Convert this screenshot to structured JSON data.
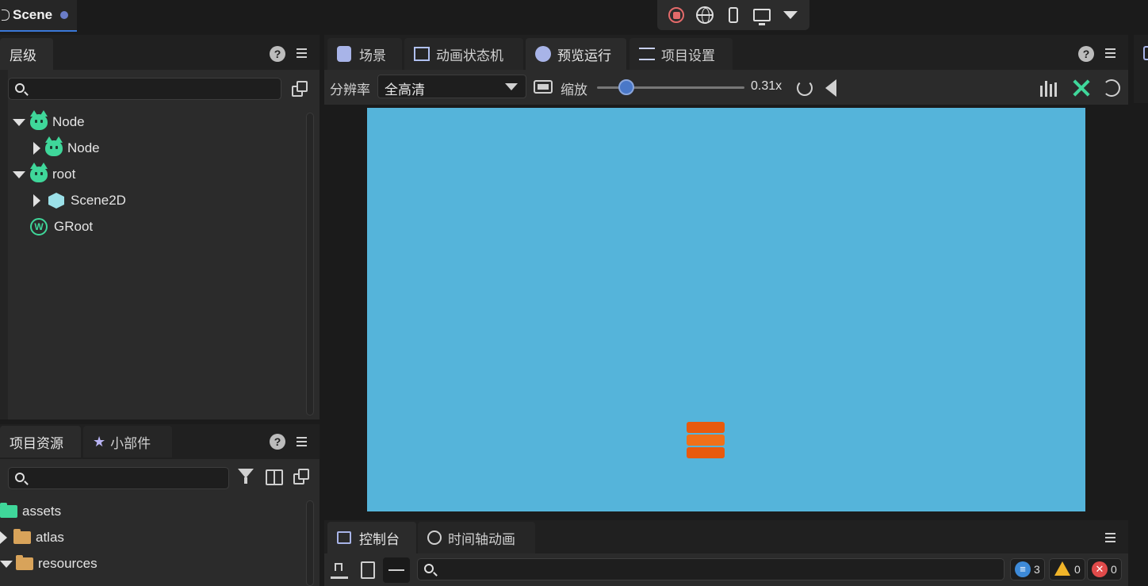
{
  "window": {
    "tab_title": "Scene"
  },
  "controls": {
    "icons": [
      "stop-icon",
      "globe-icon",
      "phone-icon",
      "monitor-icon",
      "dropdown-icon"
    ]
  },
  "hierarchy": {
    "tab_label": "层级",
    "help": "?",
    "tree": [
      {
        "label": "Node",
        "icon": "cocos-node-icon",
        "expanded": true
      },
      {
        "label": "Node",
        "icon": "cocos-node-icon",
        "expanded": false
      },
      {
        "label": "root",
        "icon": "cocos-node-icon",
        "expanded": true
      },
      {
        "label": "Scene2D",
        "icon": "cube-icon",
        "expanded": false
      },
      {
        "label": "GRoot",
        "icon": "w-circle-icon"
      }
    ]
  },
  "assets_panel": {
    "tabs": [
      "项目资源",
      "小部件"
    ],
    "help": "?",
    "items": [
      {
        "label": "assets"
      },
      {
        "label": "atlas"
      },
      {
        "label": "resources"
      }
    ]
  },
  "main": {
    "tabs": [
      "场景",
      "动画状态机",
      "预览运行",
      "项目设置"
    ],
    "active_tab": "预览运行",
    "help": "?",
    "resolution_label": "分辨率",
    "resolution_value": "全高清",
    "zoom_label": "缩放",
    "zoom_value": "0.31x",
    "zoom_level": 0.2,
    "canvas_color": "#55b4da",
    "accent_color": "#e85a0d"
  },
  "console": {
    "tabs": [
      "控制台",
      "时间轴动画"
    ],
    "counts": {
      "info": "3",
      "warning": "0",
      "error": "0"
    },
    "colors": {
      "info": "#3d8ad8",
      "warning": "#f0b429",
      "error": "#e04a4a"
    }
  }
}
